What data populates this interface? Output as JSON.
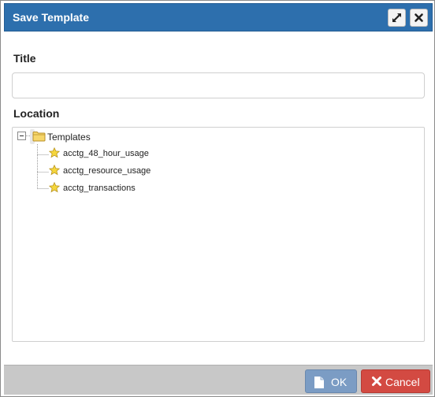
{
  "dialog": {
    "title": "Save Template",
    "maximize_icon": "expand-arrows-icon",
    "close_icon": "close-x-icon"
  },
  "form": {
    "title_label": "Title",
    "title_value": "",
    "title_placeholder": "",
    "location_label": "Location"
  },
  "tree": {
    "root": {
      "label": "Templates",
      "icon": "folder-icon",
      "expanded": true,
      "selected": true
    },
    "children": [
      {
        "label": "acctg_48_hour_usage",
        "icon": "star-icon"
      },
      {
        "label": "acctg_resource_usage",
        "icon": "star-icon"
      },
      {
        "label": "acctg_transactions",
        "icon": "star-icon"
      }
    ]
  },
  "footer": {
    "ok_label": "OK",
    "cancel_label": "Cancel"
  },
  "colors": {
    "titlebar": "#2d6fad",
    "ok_button": "#7b9cc4",
    "cancel_button": "#d34a42",
    "footer": "#c8c8c8"
  }
}
